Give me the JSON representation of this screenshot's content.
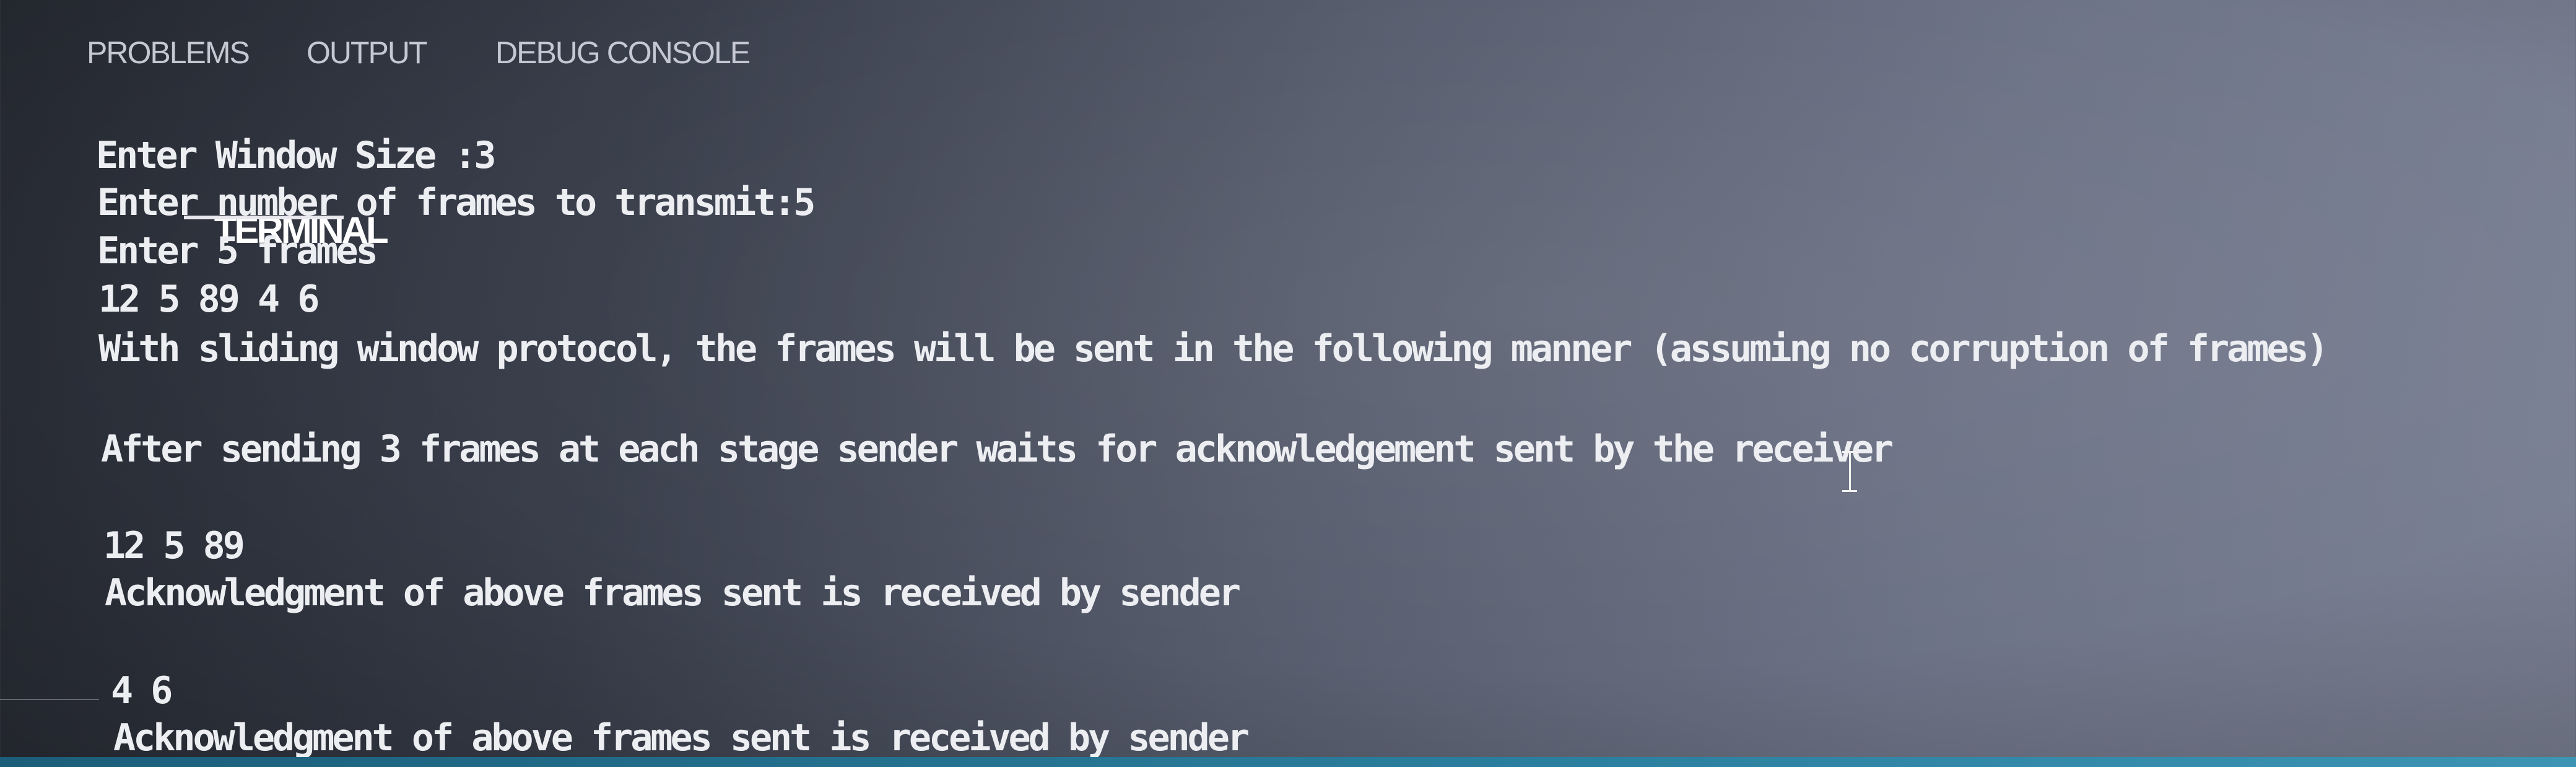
{
  "panel": {
    "tabs": [
      {
        "label": "PROBLEMS",
        "active": false
      },
      {
        "label": "OUTPUT",
        "active": false
      },
      {
        "label": "DEBUG CONSOLE",
        "active": false
      },
      {
        "label": "TERMINAL",
        "active": true
      }
    ]
  },
  "terminal": {
    "lines": [
      "Enter Window Size :3",
      "Enter number of frames to transmit:5",
      "Enter 5 frames",
      "12 5 89 4 6",
      "With sliding window protocol, the frames will be sent in the following manner (assuming no corruption of frames)",
      "After sending 3 frames at each stage sender waits for acknowledgement sent by the receiver",
      "12 5 89",
      "Acknowledgment of above frames sent is received by sender",
      "4 6",
      "Acknowledgment of above frames sent is received by sender"
    ]
  },
  "colors": {
    "terminal_text": "#eceef2",
    "active_tab": "#ffffff",
    "inactive_tab": "#c5c8d2",
    "status_strip": "#2b7f9e"
  }
}
